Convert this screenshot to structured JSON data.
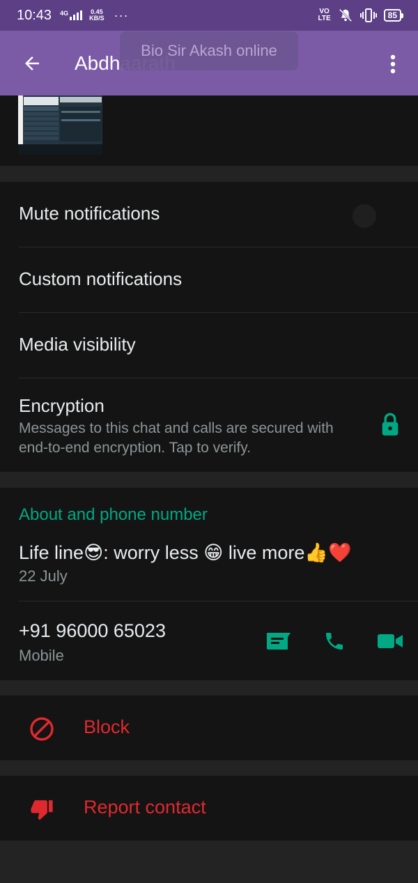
{
  "status_bar": {
    "time": "10:43",
    "network": "4G",
    "speed_value": "0.45",
    "speed_unit": "KB/S",
    "more": "···",
    "volte_top": "VO",
    "volte_bottom": "LTE",
    "battery": "85"
  },
  "app_bar": {
    "title": "Abdhaarath",
    "toast": "Bio Sir Akash online"
  },
  "settings": {
    "mute_label": "Mute notifications",
    "mute_on": false,
    "custom_label": "Custom notifications",
    "media_label": "Media visibility",
    "encryption_label": "Encryption",
    "encryption_sub": "Messages to this chat and calls are secured with end-to-end encryption. Tap to verify."
  },
  "about": {
    "section_title": "About and phone number",
    "text": "Life line😎: worry less 😁 live more👍❤️",
    "date": "22 July",
    "phone": "+91 96000 65023",
    "phone_type": "Mobile"
  },
  "actions": {
    "block_label": "Block",
    "report_label": "Report contact"
  },
  "colors": {
    "accent": "#00a884",
    "danger": "#e0292e",
    "app_bar": "#7c5ba6",
    "status_bar": "#5d3f86"
  }
}
